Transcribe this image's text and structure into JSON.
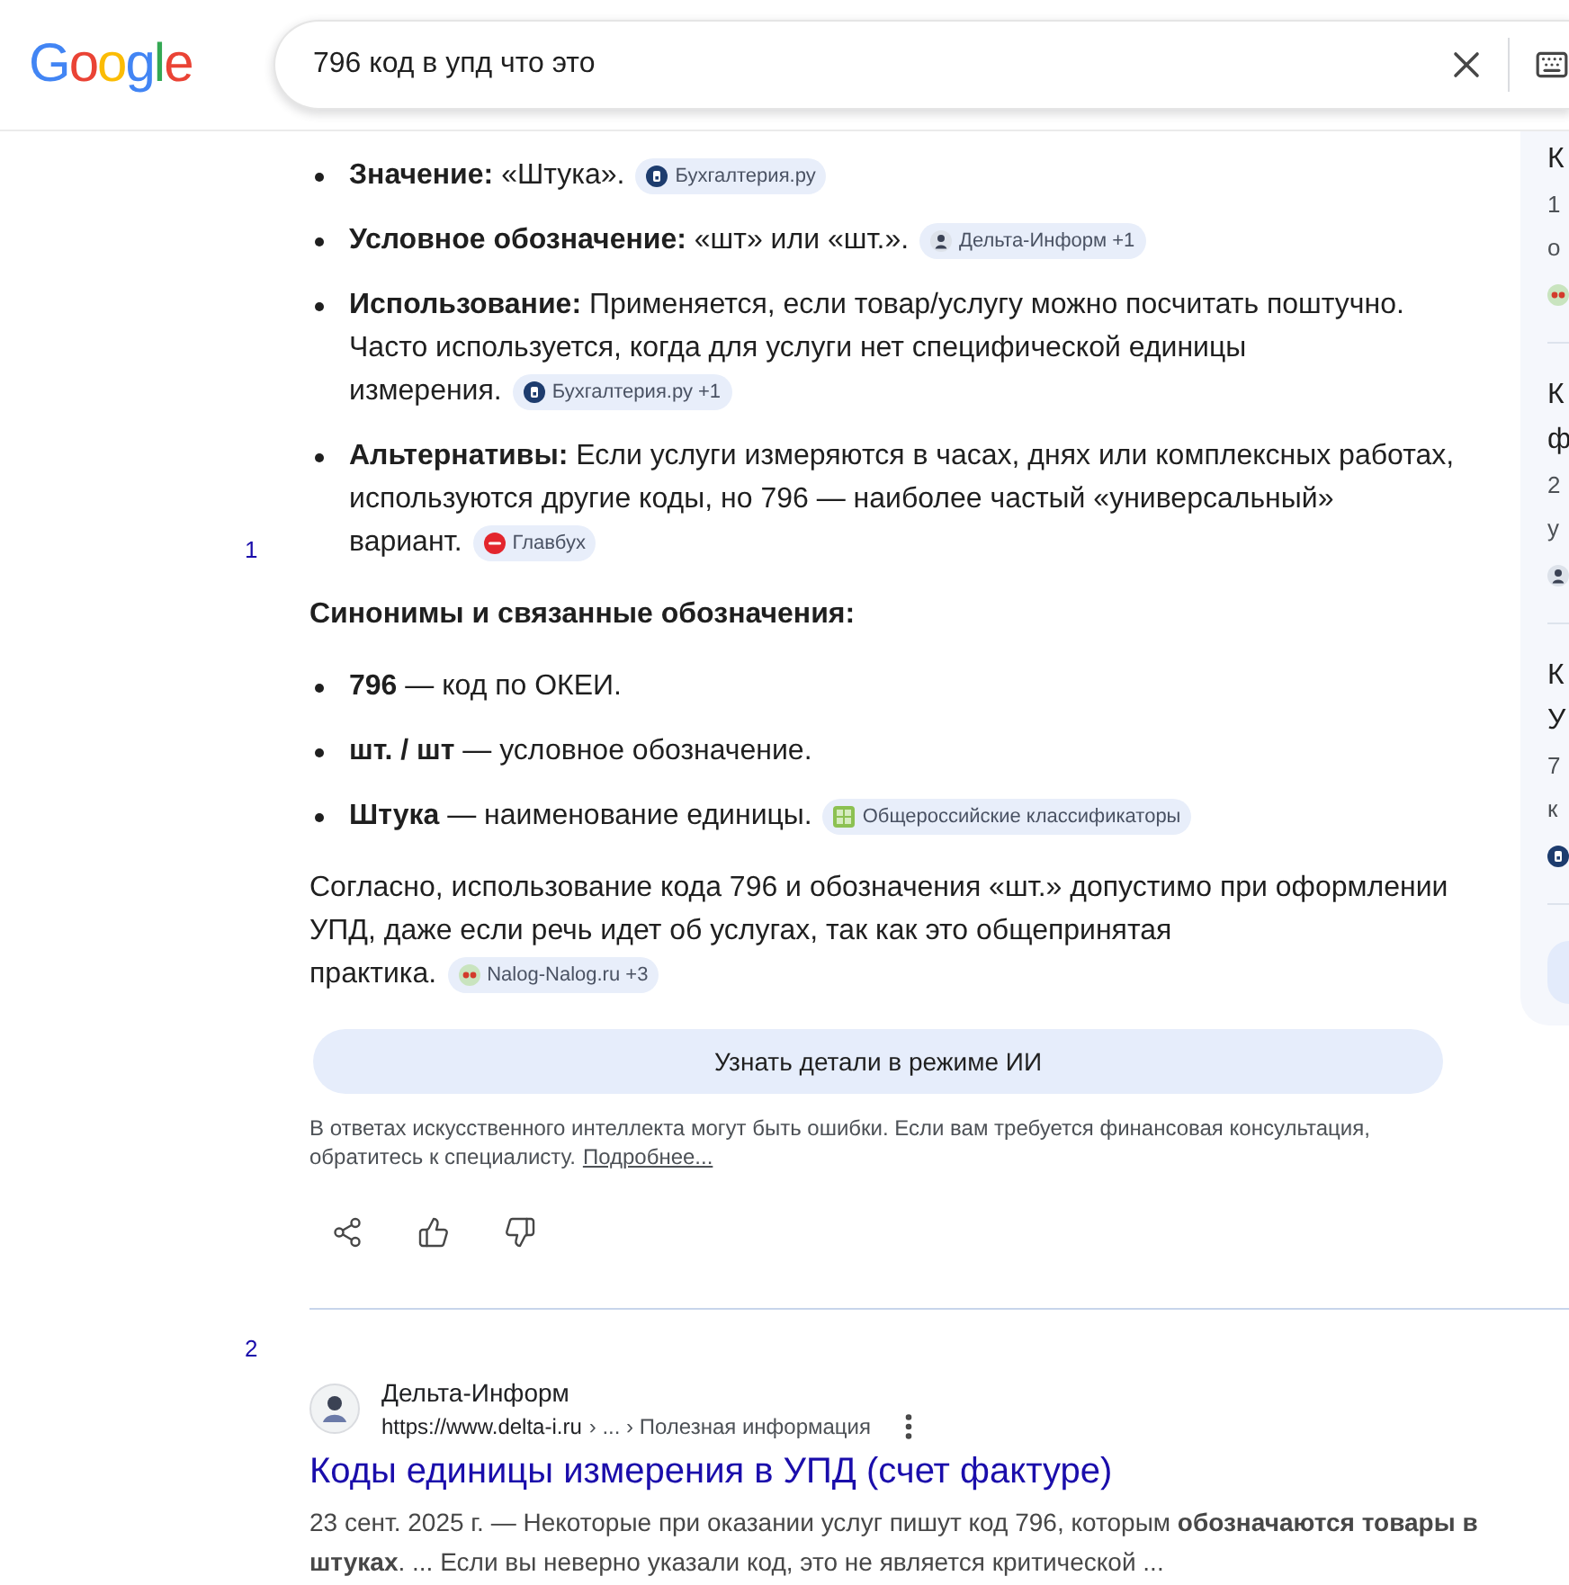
{
  "header": {
    "logo": "Google",
    "search": {
      "value": "796 код в упд что это"
    }
  },
  "overview": {
    "number": "1",
    "blocks": [
      {
        "kind": "bullet",
        "text": "**Значение:** «Штука».",
        "chip": {
          "kind": "b",
          "label": "Бухгалтерия.ру"
        }
      },
      {
        "kind": "bullet",
        "text": "**Условное обозначение:** «шт» или «шт.».",
        "chip": {
          "kind": "avatar",
          "label": "Дельта-Информ +1"
        }
      },
      {
        "kind": "bullet",
        "text": "**Использование:** Применяется, если товар/услугу можно посчитать поштучно. Часто используется, когда для услуги нет специфической единицы измерения.",
        "chip": {
          "kind": "b",
          "label": "Бухгалтерия.ру +1"
        }
      },
      {
        "kind": "bullet",
        "text": "**Альтернативы:** Если услуги измеряются в часах, днях или комплексных работах, используются другие коды, но 796 — наиболее частый «универсальный» вариант.",
        "chip": {
          "kind": "red",
          "label": "Главбух"
        }
      },
      {
        "kind": "heading",
        "text": "Синонимы и связанные обозначения:"
      },
      {
        "kind": "bullet",
        "text": "**796** — код по ОКЕИ."
      },
      {
        "kind": "bullet",
        "text": "**шт. / шт** — условное обозначение."
      },
      {
        "kind": "bullet",
        "text": "**Штука** — наименование единицы.",
        "chip": {
          "kind": "grid",
          "label": "Общероссийские классификаторы"
        }
      },
      {
        "kind": "paragraph",
        "text": "Согласно, использование кода 796 и обозначения «шт.» допустимо при оформлении УПД, даже если речь идет об услугах, так как это общепринятая практика.",
        "chip": {
          "kind": "nn",
          "label": "Nalog-Nalog.ru +3"
        }
      }
    ],
    "more_button": "Узнать детали в режиме ИИ",
    "disclaimer": "В ответах искусственного интеллекта могут быть ошибки. Если вам требуется финансовая консультация, обратитесь к специалисту.",
    "disclaimer_link": "Подробнее..."
  },
  "side_panel": {
    "cards": [
      {
        "title_lines": [
          "К"
        ],
        "snippet_lines": [
          "1",
          "о"
        ],
        "kind": "nn"
      },
      {
        "title_lines": [
          "К",
          "ф"
        ],
        "snippet_lines": [
          "2",
          "у"
        ],
        "kind": "avatar"
      },
      {
        "title_lines": [
          "К",
          "У"
        ],
        "snippet_lines": [
          "7",
          "к"
        ],
        "kind": "b"
      }
    ]
  },
  "results": [
    {
      "number": "2",
      "site": "Дельта-Информ",
      "url": "https://www.delta-i.ru",
      "path": "› ... › Полезная информация",
      "title": "Коды единицы измерения в УПД (счет фактуре)",
      "snippet": "23 сент. 2025 г. — Некоторые при оказании услуг пишут код 796, которым **обозначаются товары в штуках**. ... Если вы неверно указали код, это не является критической ..."
    }
  ]
}
